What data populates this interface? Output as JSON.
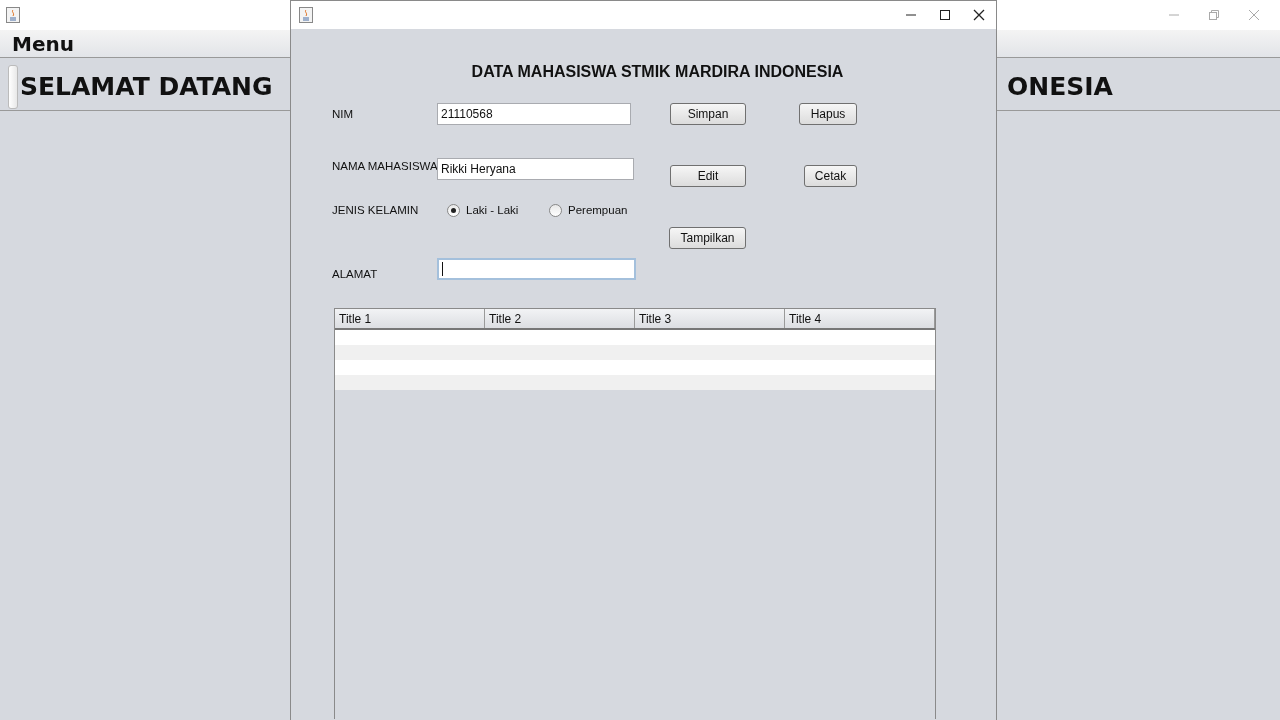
{
  "background_window": {
    "menu": [
      "Menu"
    ],
    "heading_left": "SELAMAT DATANG",
    "heading_right": "ONESIA"
  },
  "dialog": {
    "title": "DATA MAHASISWA STMIK MARDIRA INDONESIA",
    "fields": [
      {
        "label": "NIM",
        "value": "21110568",
        "focused": false
      },
      {
        "label": "NAMA MAHASISWA",
        "value": "Rikki Heryana",
        "focused": false
      },
      {
        "label": "ALAMAT",
        "focused": true
      }
    ],
    "gender": {
      "label": "JENIS KELAMIN",
      "options": [
        {
          "label": "Laki - Laki",
          "selected": true
        },
        {
          "label": "Perempuan",
          "selected": false
        }
      ]
    },
    "buttons": [
      "Simpan",
      "Hapus",
      "Edit",
      "Cetak",
      "Tampilkan"
    ],
    "table": {
      "columns": [
        "Title 1",
        "Title 2",
        "Title 3",
        "Title 4"
      ]
    }
  }
}
